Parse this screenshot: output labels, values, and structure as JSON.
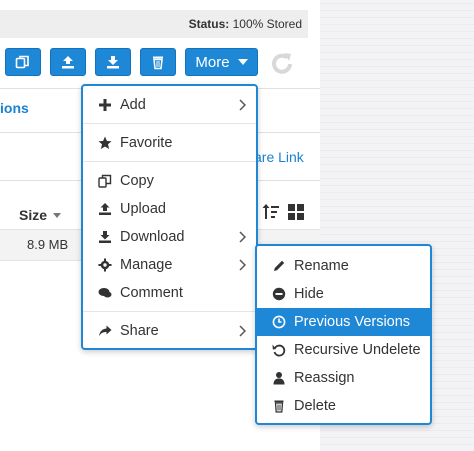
{
  "status": {
    "label": "Status:",
    "value": "100% Stored"
  },
  "toolbar": {
    "buttons": [
      "copy-icon",
      "upload-icon",
      "download-icon",
      "trash-icon"
    ],
    "more_label": "More",
    "accent": "#1e87d6"
  },
  "links": {
    "partial_left": "ions",
    "share_link": "are Link"
  },
  "table": {
    "size_header": "Size",
    "rows": [
      {
        "size": "8.9 MB"
      }
    ]
  },
  "menu": {
    "items": [
      {
        "label": "Add",
        "icon": "plus-icon",
        "submenu": true
      },
      {
        "label": "Favorite",
        "icon": "star-icon",
        "submenu": false
      },
      {
        "label": "Copy",
        "icon": "copy-icon",
        "submenu": false
      },
      {
        "label": "Upload",
        "icon": "upload-icon",
        "submenu": false
      },
      {
        "label": "Download",
        "icon": "download-icon",
        "submenu": true
      },
      {
        "label": "Manage",
        "icon": "gear-icon",
        "submenu": true
      },
      {
        "label": "Comment",
        "icon": "comment-icon",
        "submenu": false
      },
      {
        "label": "Share",
        "icon": "share-icon",
        "submenu": true
      }
    ]
  },
  "submenu": {
    "items": [
      {
        "label": "Rename",
        "icon": "pencil-icon"
      },
      {
        "label": "Hide",
        "icon": "minus-circle-icon"
      },
      {
        "label": "Previous Versions",
        "icon": "clock-icon",
        "active": true
      },
      {
        "label": "Recursive Undelete",
        "icon": "undo-icon"
      },
      {
        "label": "Reassign",
        "icon": "user-icon"
      },
      {
        "label": "Delete",
        "icon": "trash-icon"
      }
    ]
  }
}
